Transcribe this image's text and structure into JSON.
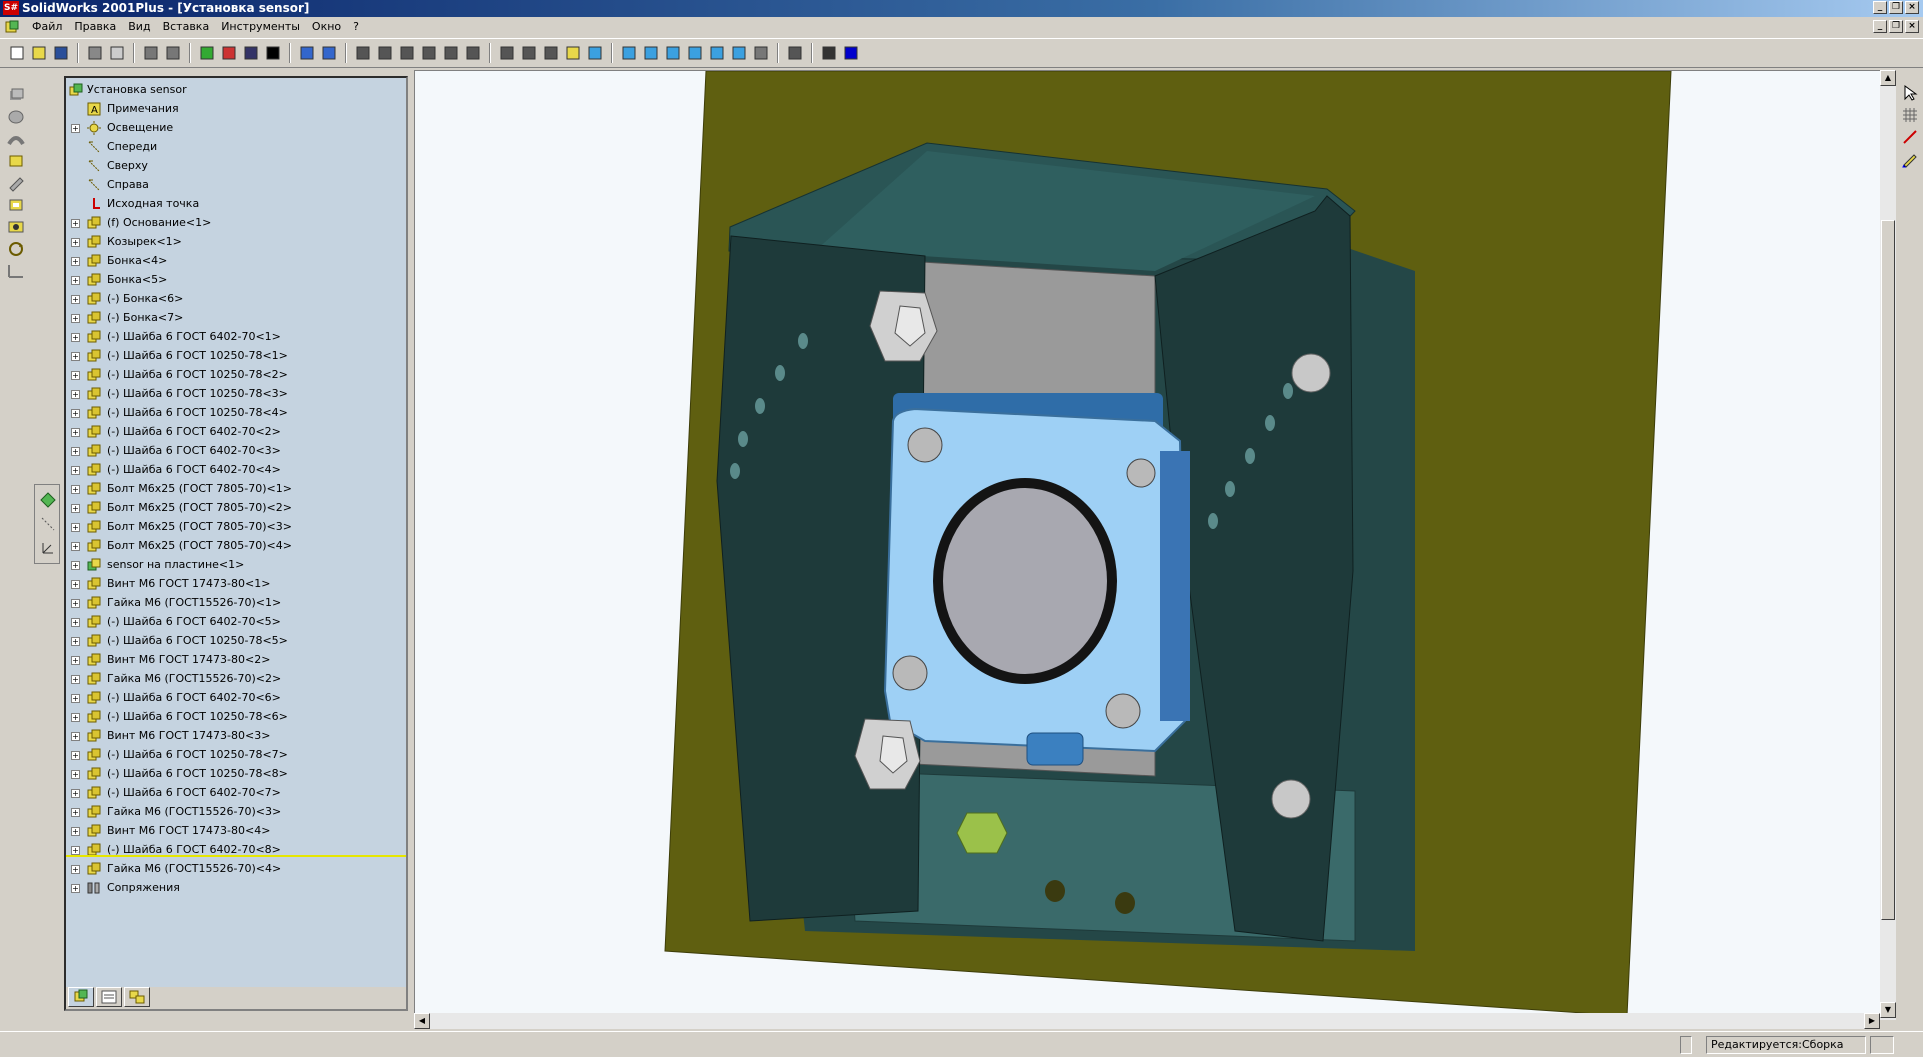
{
  "window": {
    "app_icon": "S#",
    "title": "SolidWorks 2001Plus - [Установка sensor]"
  },
  "menu": [
    "Файл",
    "Правка",
    "Вид",
    "Вставка",
    "Инструменты",
    "Окно",
    "?"
  ],
  "toolbar": {
    "buttons": [
      "new-icon",
      "open-icon",
      "save-icon",
      "print-icon",
      "print-preview-icon",
      "undo-icon",
      "redo-icon",
      "traffic-light-icon",
      "color-palette-icon",
      "options-icon",
      "whats-this-icon",
      "sketch-icon",
      "smart-dimension-icon",
      "zoom-to-fit-icon",
      "zoom-in-icon",
      "zoom-area-icon",
      "zoom-out-icon",
      "rotate-icon",
      "pan-icon",
      "wireframe-icon",
      "hidden-lines-icon",
      "hidden-removed-icon",
      "shaded-icon",
      "shaded-edges-icon",
      "view-front-icon",
      "view-back-icon",
      "view-left-icon",
      "view-right-icon",
      "view-top-icon",
      "view-iso-icon",
      "section-view-icon",
      "measure-icon",
      "mass-properties-icon",
      "interference-icon"
    ]
  },
  "tree": {
    "root": "Установка sensor",
    "items": [
      {
        "label": "Примечания",
        "icon": "annotations-icon",
        "expandable": false
      },
      {
        "label": "Освещение",
        "icon": "lighting-icon",
        "expandable": true
      },
      {
        "label": "Спереди",
        "icon": "plane-icon",
        "expandable": false
      },
      {
        "label": "Сверху",
        "icon": "plane-icon",
        "expandable": false
      },
      {
        "label": "Справа",
        "icon": "plane-icon",
        "expandable": false
      },
      {
        "label": "Исходная точка",
        "icon": "origin-icon",
        "expandable": false
      },
      {
        "label": "(f) Основание<1>",
        "icon": "part-icon",
        "expandable": true
      },
      {
        "label": "Козырек<1>",
        "icon": "part-icon",
        "expandable": true
      },
      {
        "label": "Бонка<4>",
        "icon": "part-icon",
        "expandable": true
      },
      {
        "label": "Бонка<5>",
        "icon": "part-icon",
        "expandable": true
      },
      {
        "label": "(-) Бонка<6>",
        "icon": "part-icon",
        "expandable": true
      },
      {
        "label": "(-) Бонка<7>",
        "icon": "part-icon",
        "expandable": true
      },
      {
        "label": "(-) Шайба 6 ГОСТ 6402-70<1>",
        "icon": "part-icon",
        "expandable": true
      },
      {
        "label": "(-) Шайба 6 ГОСТ 10250-78<1>",
        "icon": "part-icon",
        "expandable": true
      },
      {
        "label": "(-) Шайба 6 ГОСТ 10250-78<2>",
        "icon": "part-icon",
        "expandable": true
      },
      {
        "label": "(-) Шайба 6 ГОСТ 10250-78<3>",
        "icon": "part-icon",
        "expandable": true
      },
      {
        "label": "(-) Шайба 6 ГОСТ 10250-78<4>",
        "icon": "part-icon",
        "expandable": true
      },
      {
        "label": "(-) Шайба 6 ГОСТ 6402-70<2>",
        "icon": "part-icon",
        "expandable": true
      },
      {
        "label": "(-) Шайба 6 ГОСТ 6402-70<3>",
        "icon": "part-icon",
        "expandable": true
      },
      {
        "label": "(-) Шайба 6 ГОСТ 6402-70<4>",
        "icon": "part-icon",
        "expandable": true
      },
      {
        "label": "Болт М6х25 (ГОСТ 7805-70)<1>",
        "icon": "part-icon",
        "expandable": true
      },
      {
        "label": "Болт М6х25 (ГОСТ 7805-70)<2>",
        "icon": "part-icon",
        "expandable": true
      },
      {
        "label": "Болт М6х25 (ГОСТ 7805-70)<3>",
        "icon": "part-icon",
        "expandable": true
      },
      {
        "label": "Болт М6х25 (ГОСТ 7805-70)<4>",
        "icon": "part-icon",
        "expandable": true
      },
      {
        "label": "sensor на пластине<1>",
        "icon": "subassembly-icon",
        "expandable": true
      },
      {
        "label": "Винт М6 ГОСТ 17473-80<1>",
        "icon": "part-icon",
        "expandable": true
      },
      {
        "label": "Гайка М6 (ГОСТ15526-70)<1>",
        "icon": "part-icon",
        "expandable": true
      },
      {
        "label": "(-) Шайба 6 ГОСТ 6402-70<5>",
        "icon": "part-icon",
        "expandable": true
      },
      {
        "label": "(-) Шайба 6 ГОСТ 10250-78<5>",
        "icon": "part-icon",
        "expandable": true
      },
      {
        "label": "Винт М6 ГОСТ 17473-80<2>",
        "icon": "part-icon",
        "expandable": true
      },
      {
        "label": "Гайка М6 (ГОСТ15526-70)<2>",
        "icon": "part-icon",
        "expandable": true
      },
      {
        "label": "(-) Шайба 6 ГОСТ 6402-70<6>",
        "icon": "part-icon",
        "expandable": true
      },
      {
        "label": "(-) Шайба 6 ГОСТ 10250-78<6>",
        "icon": "part-icon",
        "expandable": true
      },
      {
        "label": "Винт М6 ГОСТ 17473-80<3>",
        "icon": "part-icon",
        "expandable": true
      },
      {
        "label": "(-) Шайба 6 ГОСТ 10250-78<7>",
        "icon": "part-icon",
        "expandable": true
      },
      {
        "label": "(-) Шайба 6 ГОСТ 10250-78<8>",
        "icon": "part-icon",
        "expandable": true
      },
      {
        "label": "(-) Шайба 6 ГОСТ 6402-70<7>",
        "icon": "part-icon",
        "expandable": true
      },
      {
        "label": "Гайка М6 (ГОСТ15526-70)<3>",
        "icon": "part-icon",
        "expandable": true
      },
      {
        "label": "Винт М6 ГОСТ 17473-80<4>",
        "icon": "part-icon",
        "expandable": true
      },
      {
        "label": "(-) Шайба 6 ГОСТ 6402-70<8>",
        "icon": "part-icon",
        "expandable": true
      },
      {
        "label": "Гайка М6 (ГОСТ15526-70)<4>",
        "icon": "part-icon",
        "expandable": true
      },
      {
        "label": "Сопряжения",
        "icon": "mates-icon",
        "expandable": true
      }
    ]
  },
  "tree_tabs": [
    "feature-manager-tab-icon",
    "property-manager-tab-icon",
    "configuration-manager-tab-icon"
  ],
  "status": {
    "mode": "Редактируется:Сборка"
  },
  "colors": {
    "plate": "#5f5f10",
    "bracket": "#203f3f",
    "sensor": "#9ed0f5",
    "viewport_bg": "#f4f8fb",
    "tree_bg": "#c5d3e0"
  }
}
